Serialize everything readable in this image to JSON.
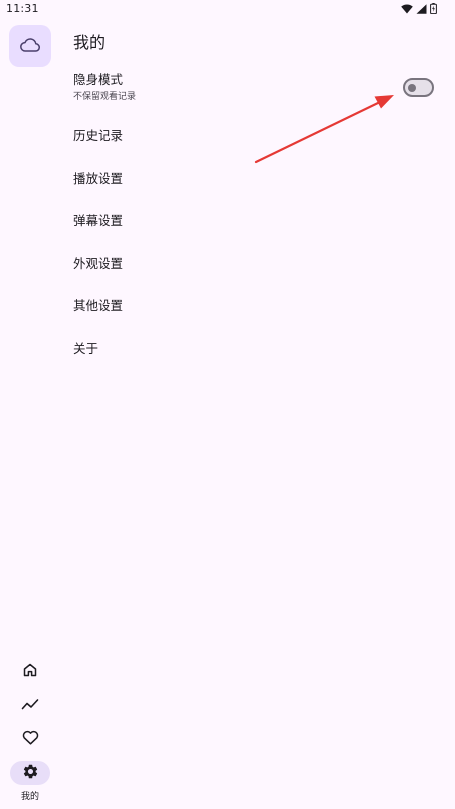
{
  "status_bar": {
    "time": "11:31",
    "icons": [
      "wifi-icon",
      "signal-icon",
      "battery-icon"
    ]
  },
  "rail": {
    "top_icon": "cloud-icon",
    "items": [
      {
        "icon": "home-icon",
        "label": "",
        "active": false
      },
      {
        "icon": "trending-icon",
        "label": "",
        "active": false
      },
      {
        "icon": "heart-icon",
        "label": "",
        "active": false
      },
      {
        "icon": "settings-icon",
        "label": "我的",
        "active": true
      }
    ]
  },
  "page": {
    "title": "我的"
  },
  "settings": {
    "incognito": {
      "label": "隐身模式",
      "sub": "不保留观看记录",
      "enabled": false
    },
    "items": [
      {
        "label": "历史记录"
      },
      {
        "label": "播放设置"
      },
      {
        "label": "弹幕设置"
      },
      {
        "label": "外观设置"
      },
      {
        "label": "其他设置"
      },
      {
        "label": "关于"
      }
    ]
  },
  "colors": {
    "background": "#FEF7FF",
    "active_container": "#E8DEF8",
    "annotation_arrow": "#E53935"
  }
}
